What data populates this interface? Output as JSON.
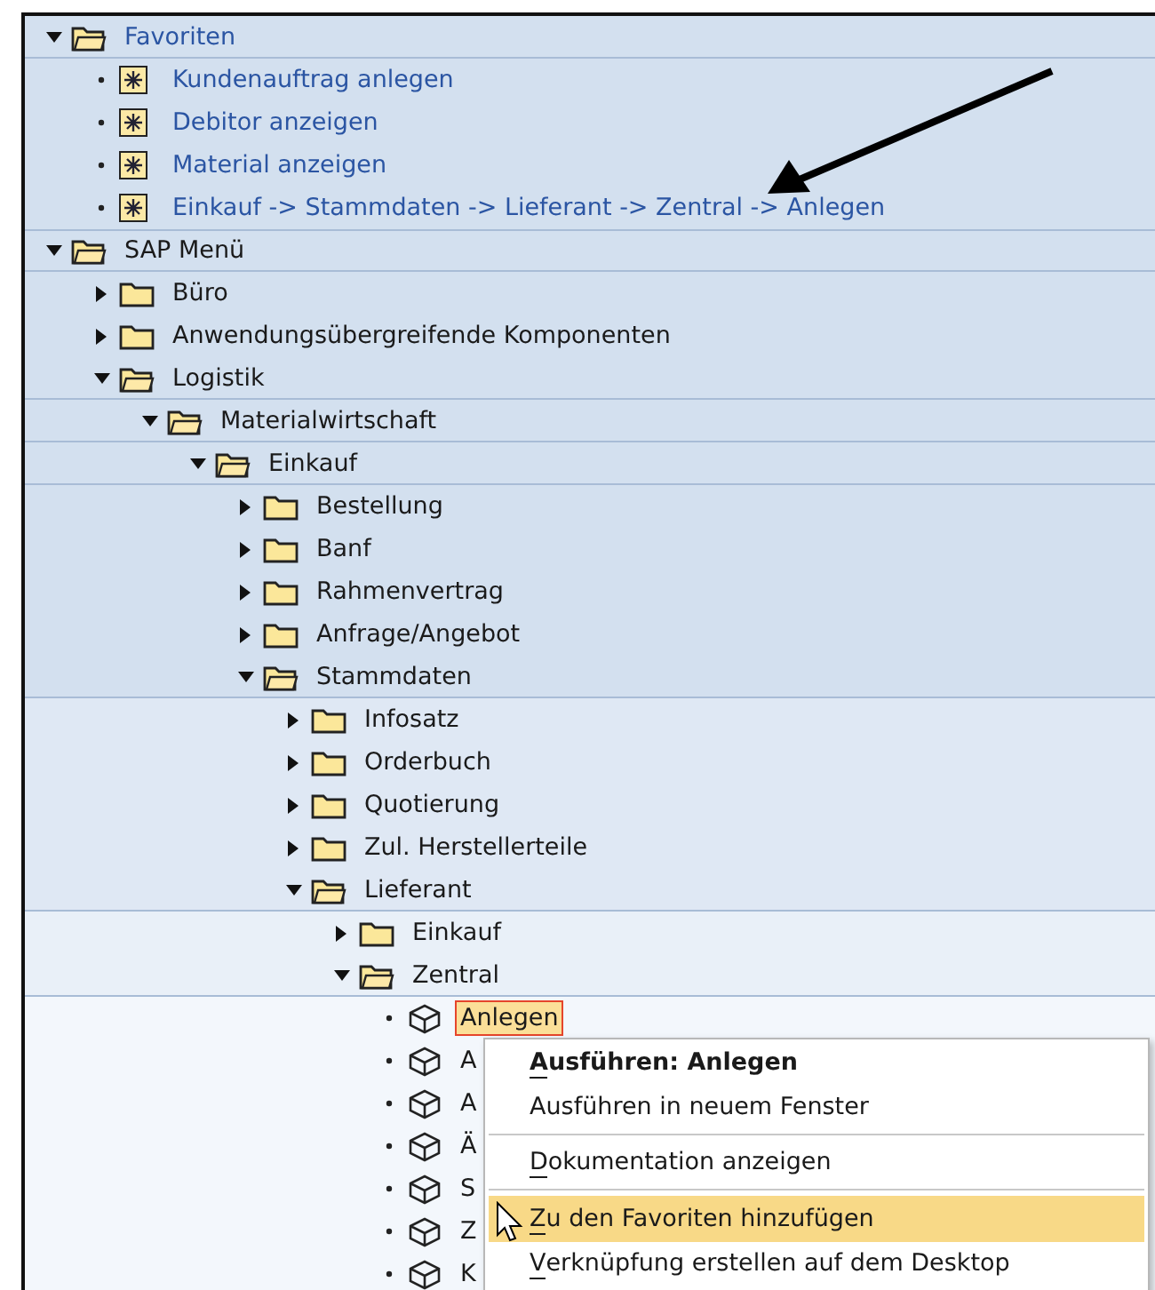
{
  "tree": [
    {
      "kind": "favorites",
      "label": "Favoriten",
      "expanded": true,
      "selected": false,
      "children": [
        {
          "kind": "favorite",
          "label": "Kundenauftrag anlegen",
          "selected": false
        },
        {
          "kind": "favorite",
          "label": "Debitor anzeigen",
          "selected": false
        },
        {
          "kind": "favorite",
          "label": "Material anzeigen",
          "selected": false
        },
        {
          "kind": "favorite",
          "label": "Einkauf -> Stammdaten -> Lieferant -> Zentral -> Anlegen",
          "selected": false
        }
      ]
    },
    {
      "kind": "folder",
      "label": "SAP Menü",
      "expanded": true,
      "selected": false,
      "children": [
        {
          "kind": "folder",
          "label": "Büro",
          "expanded": false,
          "selected": false
        },
        {
          "kind": "folder",
          "label": "Anwendungsübergreifende Komponenten",
          "expanded": false,
          "selected": false
        },
        {
          "kind": "folder",
          "label": "Logistik",
          "expanded": true,
          "selected": false,
          "children": [
            {
              "kind": "folder",
              "label": "Materialwirtschaft",
              "expanded": true,
              "selected": false,
              "children": [
                {
                  "kind": "folder",
                  "label": "Einkauf",
                  "expanded": true,
                  "selected": false,
                  "children": [
                    {
                      "kind": "folder",
                      "label": "Bestellung",
                      "expanded": false,
                      "selected": false
                    },
                    {
                      "kind": "folder",
                      "label": "Banf",
                      "expanded": false,
                      "selected": false
                    },
                    {
                      "kind": "folder",
                      "label": "Rahmenvertrag",
                      "expanded": false,
                      "selected": false
                    },
                    {
                      "kind": "folder",
                      "label": "Anfrage/Angebot",
                      "expanded": false,
                      "selected": false
                    },
                    {
                      "kind": "folder",
                      "label": "Stammdaten",
                      "expanded": true,
                      "selected": false,
                      "children": [
                        {
                          "kind": "folder",
                          "label": "Infosatz",
                          "expanded": false,
                          "selected": false
                        },
                        {
                          "kind": "folder",
                          "label": "Orderbuch",
                          "expanded": false,
                          "selected": false
                        },
                        {
                          "kind": "folder",
                          "label": "Quotierung",
                          "expanded": false,
                          "selected": false
                        },
                        {
                          "kind": "folder",
                          "label": "Zul. Herstellerteile",
                          "expanded": false,
                          "selected": false
                        },
                        {
                          "kind": "folder",
                          "label": "Lieferant",
                          "expanded": true,
                          "selected": false,
                          "children": [
                            {
                              "kind": "folder",
                              "label": "Einkauf",
                              "expanded": false,
                              "selected": false
                            },
                            {
                              "kind": "folder",
                              "label": "Zentral",
                              "expanded": true,
                              "selected": false,
                              "children": [
                                {
                                  "kind": "transaction",
                                  "label": "Anlegen",
                                  "selected": true
                                },
                                {
                                  "kind": "transaction",
                                  "label": "A",
                                  "selected": false
                                },
                                {
                                  "kind": "transaction",
                                  "label": "A",
                                  "selected": false
                                },
                                {
                                  "kind": "transaction",
                                  "label": "Ä",
                                  "selected": false
                                },
                                {
                                  "kind": "transaction",
                                  "label": "S",
                                  "selected": false
                                },
                                {
                                  "kind": "transaction",
                                  "label": "Z",
                                  "selected": false
                                },
                                {
                                  "kind": "transaction",
                                  "label": "K",
                                  "selected": false
                                }
                              ]
                            }
                          ]
                        }
                      ]
                    }
                  ]
                }
              ]
            }
          ]
        }
      ]
    }
  ],
  "context_menu": {
    "items": [
      {
        "kind": "item",
        "label": "Ausführen: Anlegen",
        "default": true,
        "mnemonic": true,
        "selected": false
      },
      {
        "kind": "item",
        "label": "Ausführen in neuem Fenster",
        "default": false,
        "mnemonic": false,
        "selected": false
      },
      {
        "kind": "separator"
      },
      {
        "kind": "item",
        "label": "Dokumentation anzeigen",
        "default": false,
        "mnemonic": true,
        "selected": false
      },
      {
        "kind": "separator"
      },
      {
        "kind": "item",
        "label": "Zu den Favoriten hinzufügen",
        "default": false,
        "mnemonic": true,
        "selected": true
      },
      {
        "kind": "item",
        "label": "Verknüpfung erstellen auf dem Desktop",
        "default": false,
        "mnemonic": true,
        "selected": false
      }
    ]
  }
}
